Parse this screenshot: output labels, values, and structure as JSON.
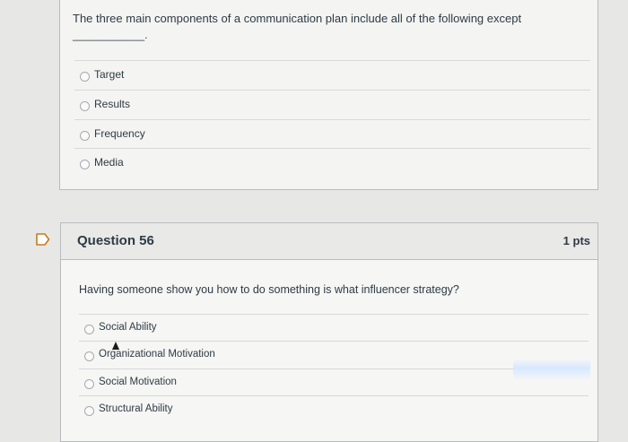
{
  "previous_question": {
    "text": "The three main components of a communication plan include all of the following except",
    "blank": "____________.",
    "answers": [
      "Target",
      "Results",
      "Frequency",
      "Media"
    ]
  },
  "question": {
    "title": "Question 56",
    "points": "1 pts",
    "text": "Having someone show you how to do something is what influencer strategy?",
    "answers": [
      "Social Ability",
      "Organizational Motivation",
      "Social Motivation",
      "Structural Ability"
    ]
  }
}
